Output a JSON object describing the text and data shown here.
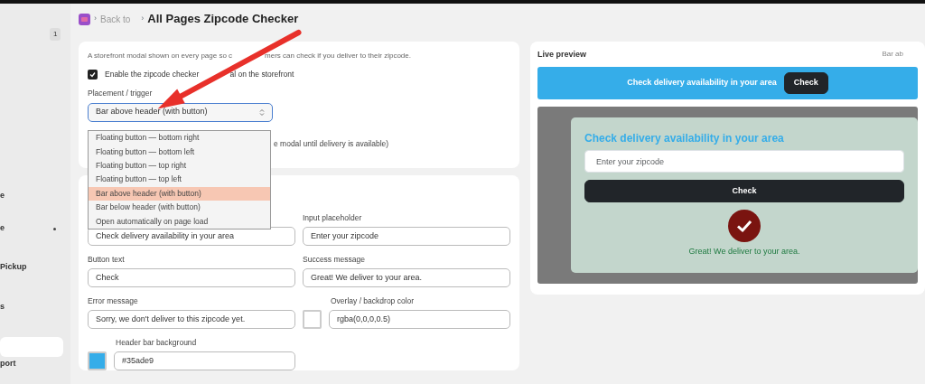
{
  "sidebar": {
    "badge": "1",
    "items": [
      {
        "label": "e",
        "dot": false,
        "selected": false
      },
      {
        "label": "e",
        "dot": true,
        "selected": false
      },
      {
        "label": "Pickup",
        "dot": false,
        "selected": false
      },
      {
        "label": "s",
        "dot": false,
        "selected": false
      },
      {
        "dot": false,
        "selected": true
      },
      {
        "label": "port",
        "dot": false,
        "selected": false
      }
    ]
  },
  "header": {
    "separators": [
      "›",
      "›"
    ],
    "back": "Back to",
    "title": "All Pages Zipcode Checker"
  },
  "settings": {
    "description": [
      "A storefront modal shown on every page so c",
      "mers can check if you deliver to their zipcode."
    ],
    "enable": {
      "label": [
        "Enable the zipcode checker",
        "al on the storefront"
      ],
      "checked": true
    },
    "placement_label": "Placement / trigger",
    "placement_value": "Bar above header (with button)",
    "options": [
      {
        "label": "Floating button — bottom right",
        "selected": false
      },
      {
        "label": "Floating button — bottom left",
        "selected": false
      },
      {
        "label": "Floating button — top right",
        "selected": false
      },
      {
        "label": "Floating button — top left",
        "selected": false
      },
      {
        "label": "Bar above header (with button)",
        "selected": true
      },
      {
        "label": "Bar below header (with button)",
        "selected": false
      },
      {
        "label": "Open automatically on page load",
        "selected": false
      }
    ],
    "hidden_option_text": "e modal until delivery is available)"
  },
  "fields": [
    {
      "kind": "text",
      "value": "Check delivery availability in your area"
    },
    {
      "kind": "text",
      "label": "Input placeholder",
      "value": "Enter your zipcode"
    },
    {
      "kind": "text",
      "label": "Button text",
      "value": "Check"
    },
    {
      "kind": "text",
      "label": "Success message",
      "value": "Great! We deliver to your area."
    },
    {
      "kind": "text",
      "label": "Error message",
      "value": "Sorry, we don't deliver to this zipcode yet."
    },
    {
      "kind": "color",
      "label": "Overlay / backdrop color",
      "value": "rgba(0,0,0,0.5)",
      "color": "#ffffff"
    },
    {
      "kind": "color",
      "label": "Header bar background",
      "value": "#35ade9",
      "color": "#35ade9"
    }
  ],
  "preview": {
    "title": "Live preview",
    "mode": "Bar ab",
    "bar": {
      "text": "Check delivery availability in your area",
      "button": "Check"
    },
    "modal": {
      "title": "Check delivery availability in your area",
      "placeholder": "Enter your zipcode",
      "button": "Check",
      "success": "Great! We deliver to your area."
    }
  }
}
